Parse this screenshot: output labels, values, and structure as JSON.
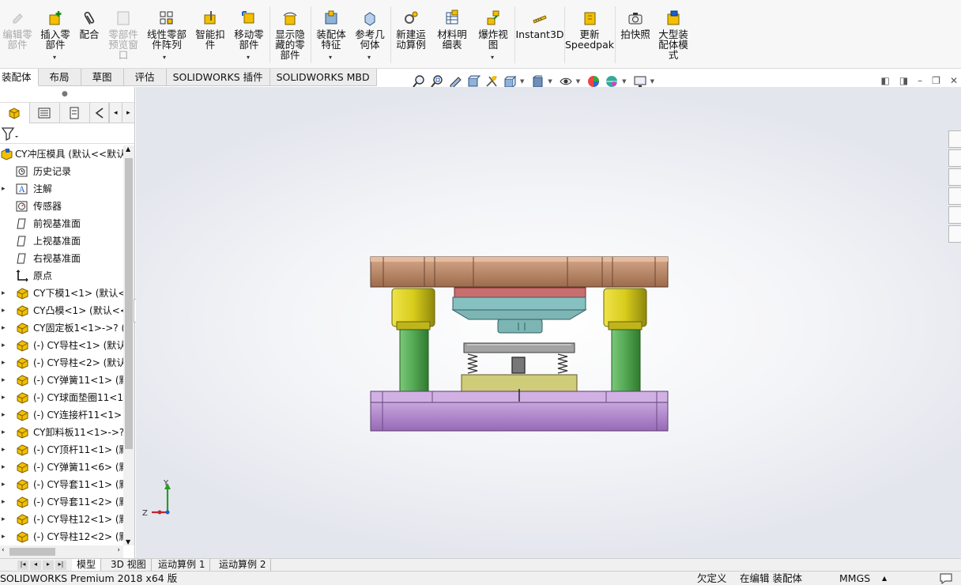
{
  "ribbon": {
    "buttons": [
      {
        "label": "编辑零\n部件",
        "disabled": true
      },
      {
        "label": "插入零\n部件",
        "disabled": false,
        "dropdown": "▾"
      },
      {
        "label": "配合",
        "disabled": false
      },
      {
        "label": "零部件\n预览窗\n口",
        "disabled": true
      },
      {
        "label": "线性零部\n件阵列",
        "disabled": false,
        "dropdown": "▾"
      },
      {
        "label": "智能扣\n件",
        "disabled": false
      },
      {
        "label": "移动零\n部件",
        "disabled": false,
        "dropdown": "▾"
      },
      {
        "label": "显示隐\n藏的零\n部件",
        "disabled": false
      },
      {
        "label": "装配体\n特征",
        "disabled": false,
        "dropdown": "▾"
      },
      {
        "label": "参考几\n何体",
        "disabled": false,
        "dropdown": "▾"
      },
      {
        "label": "新建运\n动算例",
        "disabled": false
      },
      {
        "label": "材料明\n细表",
        "disabled": false
      },
      {
        "label": "爆炸视\n图",
        "disabled": false,
        "dropdown": "▾"
      },
      {
        "label": "Instant3D",
        "disabled": false
      },
      {
        "label": "更新\nSpeedpak",
        "disabled": false
      },
      {
        "label": "拍快照",
        "disabled": false
      },
      {
        "label": "大型装\n配体模\n式",
        "disabled": false
      }
    ]
  },
  "command_tabs": [
    "装配体",
    "布局",
    "草图",
    "评估",
    "SOLIDWORKS 插件",
    "SOLIDWORKS MBD"
  ],
  "hud_icons": [
    "zoom-to-fit-icon",
    "zoom-area-icon",
    "previous-view-icon",
    "section-view-icon",
    "dynamic-annotation-icon",
    "view-orientation-icon",
    "display-style-icon",
    "hide-show-icon",
    "edit-appearance-icon",
    "apply-scene-icon",
    "view-settings-icon"
  ],
  "feature_manager": {
    "tabs": [
      "feature-tree-tab",
      "property-manager-tab",
      "configuration-manager-tab",
      "dimxpert-tab"
    ],
    "root": "CY冲压模具  (默认<<默认>",
    "items": [
      {
        "label": "历史记录",
        "icon": "history-icon",
        "expand": false
      },
      {
        "label": "注解",
        "icon": "annotation-icon",
        "expand": true
      },
      {
        "label": "传感器",
        "icon": "sensor-icon",
        "expand": false
      },
      {
        "label": "前视基准面",
        "icon": "plane-icon",
        "expand": false
      },
      {
        "label": "上视基准面",
        "icon": "plane-icon",
        "expand": false
      },
      {
        "label": "右视基准面",
        "icon": "plane-icon",
        "expand": false
      },
      {
        "label": "原点",
        "icon": "origin-icon",
        "expand": false
      },
      {
        "label": "CY下模1<1> (默认<",
        "icon": "part-icon",
        "expand": true
      },
      {
        "label": "CY凸模<1> (默认<<",
        "icon": "part-icon",
        "expand": true
      },
      {
        "label": "CY固定板1<1>->? (",
        "icon": "part-icon",
        "expand": true
      },
      {
        "label": "(-) CY导柱<1> (默认",
        "icon": "part-icon",
        "expand": true
      },
      {
        "label": "(-) CY导柱<2> (默认",
        "icon": "part-icon",
        "expand": true
      },
      {
        "label": "(-) CY弹簧11<1> (默",
        "icon": "part-icon",
        "expand": true
      },
      {
        "label": "(-) CY球面垫圈11<1",
        "icon": "part-icon",
        "expand": true
      },
      {
        "label": "(-) CY连接杆11<1>",
        "icon": "part-icon",
        "expand": true
      },
      {
        "label": "CY卸料板11<1>->?",
        "icon": "part-icon",
        "expand": true
      },
      {
        "label": "(-) CY顶杆11<1> (默",
        "icon": "part-icon",
        "expand": true
      },
      {
        "label": "(-) CY弹簧11<6> (默",
        "icon": "part-icon",
        "expand": true
      },
      {
        "label": "(-) CY导套11<1> (默",
        "icon": "part-icon",
        "expand": true
      },
      {
        "label": "(-) CY导套11<2> (默",
        "icon": "part-icon",
        "expand": true
      },
      {
        "label": "(-) CY导柱12<1> (默",
        "icon": "part-icon",
        "expand": true
      },
      {
        "label": "(-) CY导柱12<2> (默",
        "icon": "part-icon",
        "expand": true
      }
    ]
  },
  "triad": {
    "y": "Y",
    "z": "Z"
  },
  "bottom_tabs": [
    "模型",
    "3D 视图",
    "运动算例 1",
    "运动算例 2"
  ],
  "status": {
    "app": "SOLIDWORKS Premium 2018 x64 版",
    "defined": "欠定义",
    "editing": "在编辑 装配体",
    "units": "MMGS",
    "units_caret": "▲"
  },
  "colors": {
    "upper_plate": "#b88a6c",
    "guide_bushing": "#d7cf2a",
    "guide_pillar": "#5cae5c",
    "lower_plate": "#a77cc2",
    "punch_holder": "#c77070",
    "punch": "#7fb9b9",
    "stripper": "#9b9b9b",
    "die": "#cfcc7a"
  }
}
